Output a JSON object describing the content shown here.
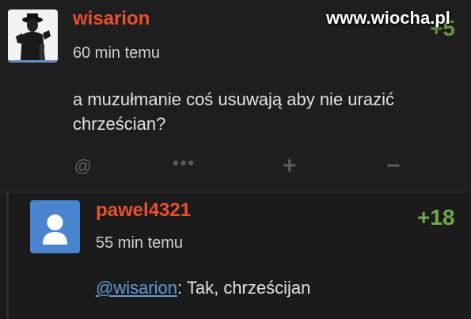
{
  "watermark": "www.wiocha.pl",
  "comments": [
    {
      "username": "wisarion",
      "time": "60 min temu",
      "text": "a muzułmanie coś usuwają aby nie urazić chrześcian?",
      "score": "+5",
      "avatar": "user-photo-avatar"
    },
    {
      "username": "pawel4321",
      "time": "55 min temu",
      "mention": "@wisarion",
      "text": ": Tak, chrześcijan",
      "score": "+18",
      "avatar": "default-user-avatar"
    }
  ],
  "actions": {
    "reply": "@",
    "more": "•••",
    "upvote": "+",
    "downvote": "−"
  },
  "colors": {
    "username": "#e8502e",
    "score": "#6fa84a",
    "mention": "#5f9ad6",
    "background": "#1e1e1e"
  }
}
